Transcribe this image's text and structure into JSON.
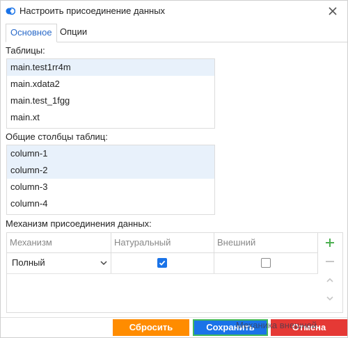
{
  "window": {
    "title": "Настроить присоединение данных"
  },
  "tabs": [
    {
      "label": "Основное",
      "active": true
    },
    {
      "label": "Опции",
      "active": false
    }
  ],
  "tables": {
    "label": "Таблицы:",
    "items": [
      {
        "label": "main.test1rr4m",
        "selected": true
      },
      {
        "label": "main.xdata2",
        "selected": false
      },
      {
        "label": "main.test_1fgg",
        "selected": false
      },
      {
        "label": "main.xt",
        "selected": false
      }
    ]
  },
  "columns": {
    "label": "Общие столбцы таблиц:",
    "items": [
      {
        "label": "column-1",
        "selected": true
      },
      {
        "label": "column-2",
        "selected": true
      },
      {
        "label": "column-3",
        "selected": false
      },
      {
        "label": "column-4",
        "selected": false
      }
    ]
  },
  "join": {
    "label": "Механизм присоединения данных:",
    "headers": [
      "Механизм",
      "Натуральный",
      "Внешний"
    ],
    "rows": [
      {
        "mechanism": "Полный",
        "natural": true,
        "outer": false
      }
    ]
  },
  "buttons": {
    "reset": "Сбросить",
    "save": "Сохранить",
    "cancel": "Отмена"
  },
  "overlay": "Механика внешней",
  "colors": {
    "accent": "#1a73e8",
    "reset": "#ff8c00",
    "cancel": "#e53935",
    "add": "#4caf50",
    "selection": "#e8f1fb"
  },
  "icons": {
    "app": "join-circles-icon",
    "close": "close-icon",
    "add": "plus-icon",
    "remove": "minus-icon",
    "up": "chevron-up-icon",
    "down": "chevron-down-icon"
  }
}
